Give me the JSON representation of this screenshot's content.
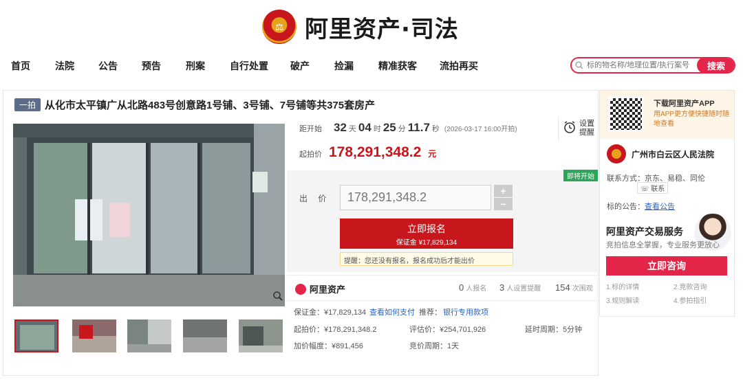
{
  "brand": {
    "name": "阿里资产·司法",
    "emblem_char": "⚖"
  },
  "nav": {
    "items": [
      "首页",
      "法院",
      "公告",
      "预告",
      "刑案",
      "自行处置",
      "破产",
      "捡漏",
      "精准获客",
      "流拍再买"
    ]
  },
  "search": {
    "placeholder": "标的物名称/地理位置/执行案号",
    "button": "搜索"
  },
  "item": {
    "tag": "一拍",
    "title": "从化市太平镇广从北路483号创意路1号铺、3号铺、7号铺等共375套房产"
  },
  "countdown": {
    "label": "距开始",
    "days": "32",
    "days_unit": "天",
    "hours": "04",
    "hours_unit": "时",
    "minutes": "25",
    "minutes_unit": "分",
    "seconds": "11.7",
    "seconds_unit": "秒",
    "start_note": "(2026-03-17 16:00开拍)",
    "remind_label1": "设置",
    "remind_label2": "提醒"
  },
  "start_price": {
    "label": "起拍价",
    "value": "178,291,348.2",
    "unit": "元"
  },
  "bid": {
    "badge": "即将开始",
    "label": "出 价",
    "value": "178,291,348.2",
    "plus": "+",
    "minus": "−",
    "signup_label": "立即报名",
    "deposit_label": "保证金 ¥17,829,134",
    "notice": "提醒：您还没有报名，报名成功后才能出价"
  },
  "stats": {
    "brand": "阿里资产",
    "signups": "0",
    "signups_label": "人报名",
    "reminders": "3",
    "reminders_label": "人设置提醒",
    "views": "154",
    "views_label": "次围观"
  },
  "details": {
    "deposit": "保证金：¥17,829,134",
    "how_to_pay": "查看如何支付",
    "recommend": "推荐：",
    "bank_loan": "银行专用款项",
    "start_price": "起拍价：¥178,291,348.2",
    "appraisal": "评估价：¥254,701,926",
    "delay": "延时周期：5分钟",
    "increment": "加价幅度：¥891,456",
    "period": "竞价周期：1天"
  },
  "side": {
    "app_title": "下载阿里资产APP",
    "app_sub": "用APP更方便快捷随时随地查看",
    "court": "广州市白云区人民法院",
    "contact": "联系方式：京东、易稳、同伦",
    "contact_btn": "联系",
    "announcement_label": "标的公告：",
    "announcement_link": "查看公告"
  },
  "service": {
    "title": "阿里资产交易服务",
    "subtitle": "竞拍信息全掌握，专业服务更放心",
    "button": "立即咨询",
    "links": [
      "1.标的详情",
      "2.竞款咨询",
      "3.规则解读",
      "4.参拍指引"
    ]
  },
  "colors": {
    "brand_red": "#c8161d",
    "accent_pink": "#e4254a",
    "link_blue": "#2b64c4",
    "badge_green": "#2ca55a"
  }
}
